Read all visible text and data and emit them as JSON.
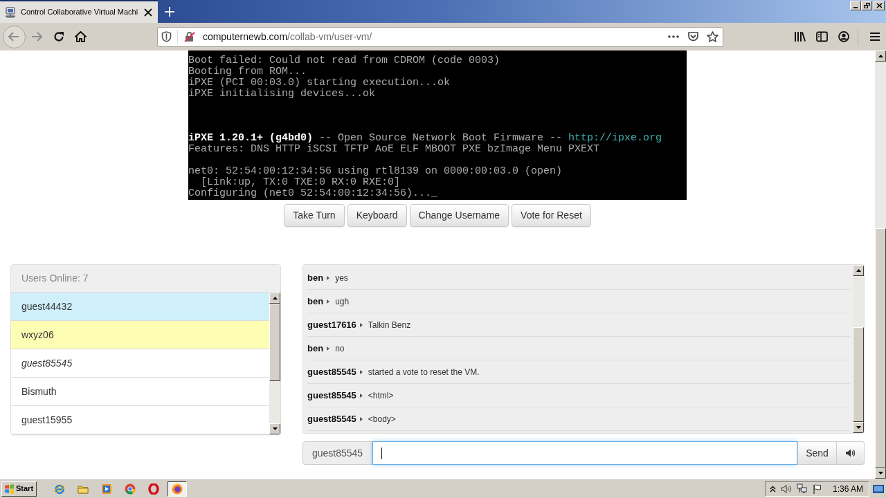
{
  "browser": {
    "tabs": [
      {
        "title": "Control Collaborative Virtual Machi",
        "selected": true
      }
    ],
    "navigation": {
      "back": {
        "disabled": true
      },
      "forward": {
        "disabled": true
      }
    },
    "address_bar": {
      "domain": "computernewb.com",
      "path": "/collab-vm/user-vm/"
    }
  },
  "vm_screen": {
    "blocks": [
      {
        "lines": [
          {
            "segments": [
              {
                "text": "Boot failed: Could not read from CDROM (code 0003)",
                "kind": "normal"
              }
            ]
          },
          {
            "segments": [
              {
                "text": "Booting from ROM...",
                "kind": "normal"
              }
            ]
          },
          {
            "segments": [
              {
                "text": "iPXE (PCI 00:03.0) starting execution...ok",
                "kind": "normal"
              }
            ]
          },
          {
            "segments": [
              {
                "text": "iPXE initialising devices...ok",
                "kind": "normal"
              }
            ]
          }
        ]
      },
      {
        "lines": [
          {
            "segments": [
              {
                "text": "iPXE 1.20.1+ (g4bd0)",
                "kind": "bright"
              },
              {
                "text": " -- Open Source Network Boot Firmware -- ",
                "kind": "normal"
              },
              {
                "text": "http://ipxe.org",
                "kind": "link"
              }
            ]
          },
          {
            "segments": [
              {
                "text": "Features: DNS HTTP iSCSI TFTP AoE ELF MBOOT PXE bzImage Menu PXEXT",
                "kind": "normal"
              }
            ]
          }
        ]
      },
      {
        "lines": [
          {
            "segments": [
              {
                "text": "net0: 52:54:00:12:34:56 using rtl8139 on 0000:00:03.0 (open)",
                "kind": "normal"
              }
            ]
          },
          {
            "segments": [
              {
                "text": "  [Link:up, TX:0 TXE:0 RX:0 RXE:0]",
                "kind": "normal"
              }
            ]
          },
          {
            "segments": [
              {
                "text": "Configuring (net0 52:54:00:12:34:56)..._",
                "kind": "normal"
              }
            ]
          }
        ]
      }
    ]
  },
  "vm_buttons": [
    "Take Turn",
    "Keyboard",
    "Change Username",
    "Vote for Reset"
  ],
  "users_panel": {
    "title": "Users Online: 7",
    "users": [
      {
        "name": "guest44432",
        "kind": "turn",
        "self": false
      },
      {
        "name": "wxyz06",
        "kind": "waiting",
        "self": false
      },
      {
        "name": "guest85545",
        "kind": "plain",
        "self": true
      },
      {
        "name": "Bismuth",
        "kind": "plain",
        "self": false
      },
      {
        "name": "guest15955",
        "kind": "plain",
        "self": false
      }
    ]
  },
  "chat": {
    "messages": [
      {
        "user": "ben",
        "text": "yes"
      },
      {
        "user": "ben",
        "text": "ugh"
      },
      {
        "user": "guest17616",
        "text": "Talkin Benz"
      },
      {
        "user": "ben",
        "text": "no"
      },
      {
        "user": "guest85545",
        "text": "started a vote to reset the VM."
      },
      {
        "user": "guest85545",
        "text": "<html>"
      },
      {
        "user": "guest85545",
        "text": "<body>"
      }
    ],
    "input": {
      "username": "guest85545",
      "focused": true,
      "send_label": "Send"
    }
  },
  "taskbar": {
    "start_label": "Start",
    "apps": [
      {
        "kind": "orbit",
        "active": false
      },
      {
        "kind": "folder",
        "active": false
      },
      {
        "kind": "player",
        "active": false
      },
      {
        "kind": "wheel",
        "active": false
      },
      {
        "kind": "ring",
        "active": false
      },
      {
        "kind": "orb",
        "active": true
      }
    ],
    "clock": "1:36 AM"
  }
}
